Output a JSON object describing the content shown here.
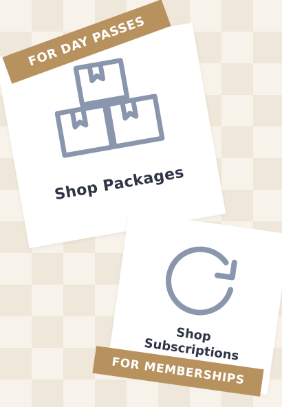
{
  "cards": {
    "packages": {
      "label": "Shop Packages",
      "icon": "packages-icon",
      "tag": "FOR DAY PASSES"
    },
    "subscriptions": {
      "label_line1": "Shop",
      "label_line2": "Subscriptions",
      "icon": "refresh-icon",
      "tag": "FOR MEMBERSHIPS"
    }
  },
  "colors": {
    "tag_bg": "#b8925e",
    "icon_stroke": "#8a96ad",
    "text": "#2f3545"
  }
}
